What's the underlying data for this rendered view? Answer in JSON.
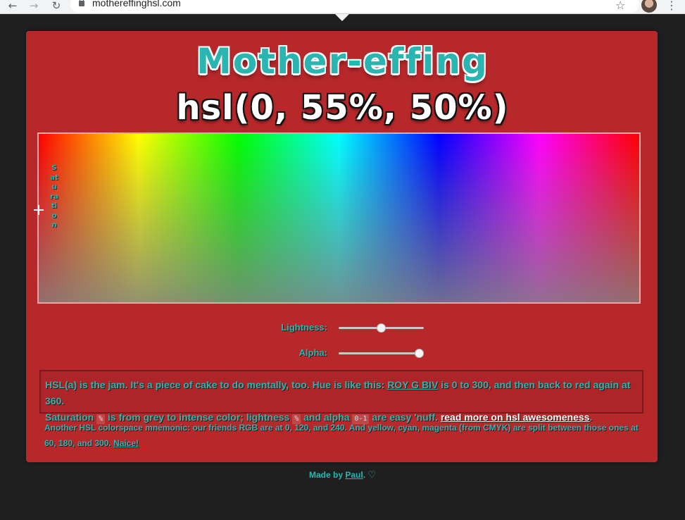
{
  "browser": {
    "url": "mothereffinghsl.com",
    "back_icon": "←",
    "forward_icon": "→",
    "reload_icon": "↻",
    "star_icon": "☆",
    "menu_icon": "⋮"
  },
  "header": {
    "title_line1": "Mother-effing",
    "title_line2": "hsl(0, 55%, 50%)"
  },
  "picker": {
    "saturation_label": "Saturation"
  },
  "sliders": {
    "lightness_label": "Lightness:",
    "lightness_value": 0.5,
    "alpha_label": "Alpha:",
    "alpha_value": 1
  },
  "info": {
    "p1": "HSL(a) is the jam. It's a piece of cake to do mentally, too. Hue is like this: ",
    "roygbiv": "ROY G BIV",
    "p2": " is 0 to 300, and then back to red again at 360.",
    "p3": "Saturation ",
    "pct1": "%",
    "p4": " is from grey to intense color; lightness ",
    "pct2": "%",
    "p5": " and alpha ",
    "range": "0-1",
    "p6": " are easy 'nuff. ",
    "read_more": "read more on hsl awesomeness",
    "p7": "."
  },
  "note": {
    "text": "Another HSL colorspace mnemonic: our friends RGB are at 0, 120, and 240. And yellow, cyan, magenta (from CMYK) are split between those ones at 60, 180, and 300. ",
    "link": "Naice!"
  },
  "footer": {
    "prefix": "Made by ",
    "author": "Paul",
    "suffix": ". ",
    "heart": "♡"
  },
  "colors": {
    "card_bg": "#b7282b",
    "accent_teal": "#2bb5b0",
    "page_bg": "#1f1f1f"
  }
}
